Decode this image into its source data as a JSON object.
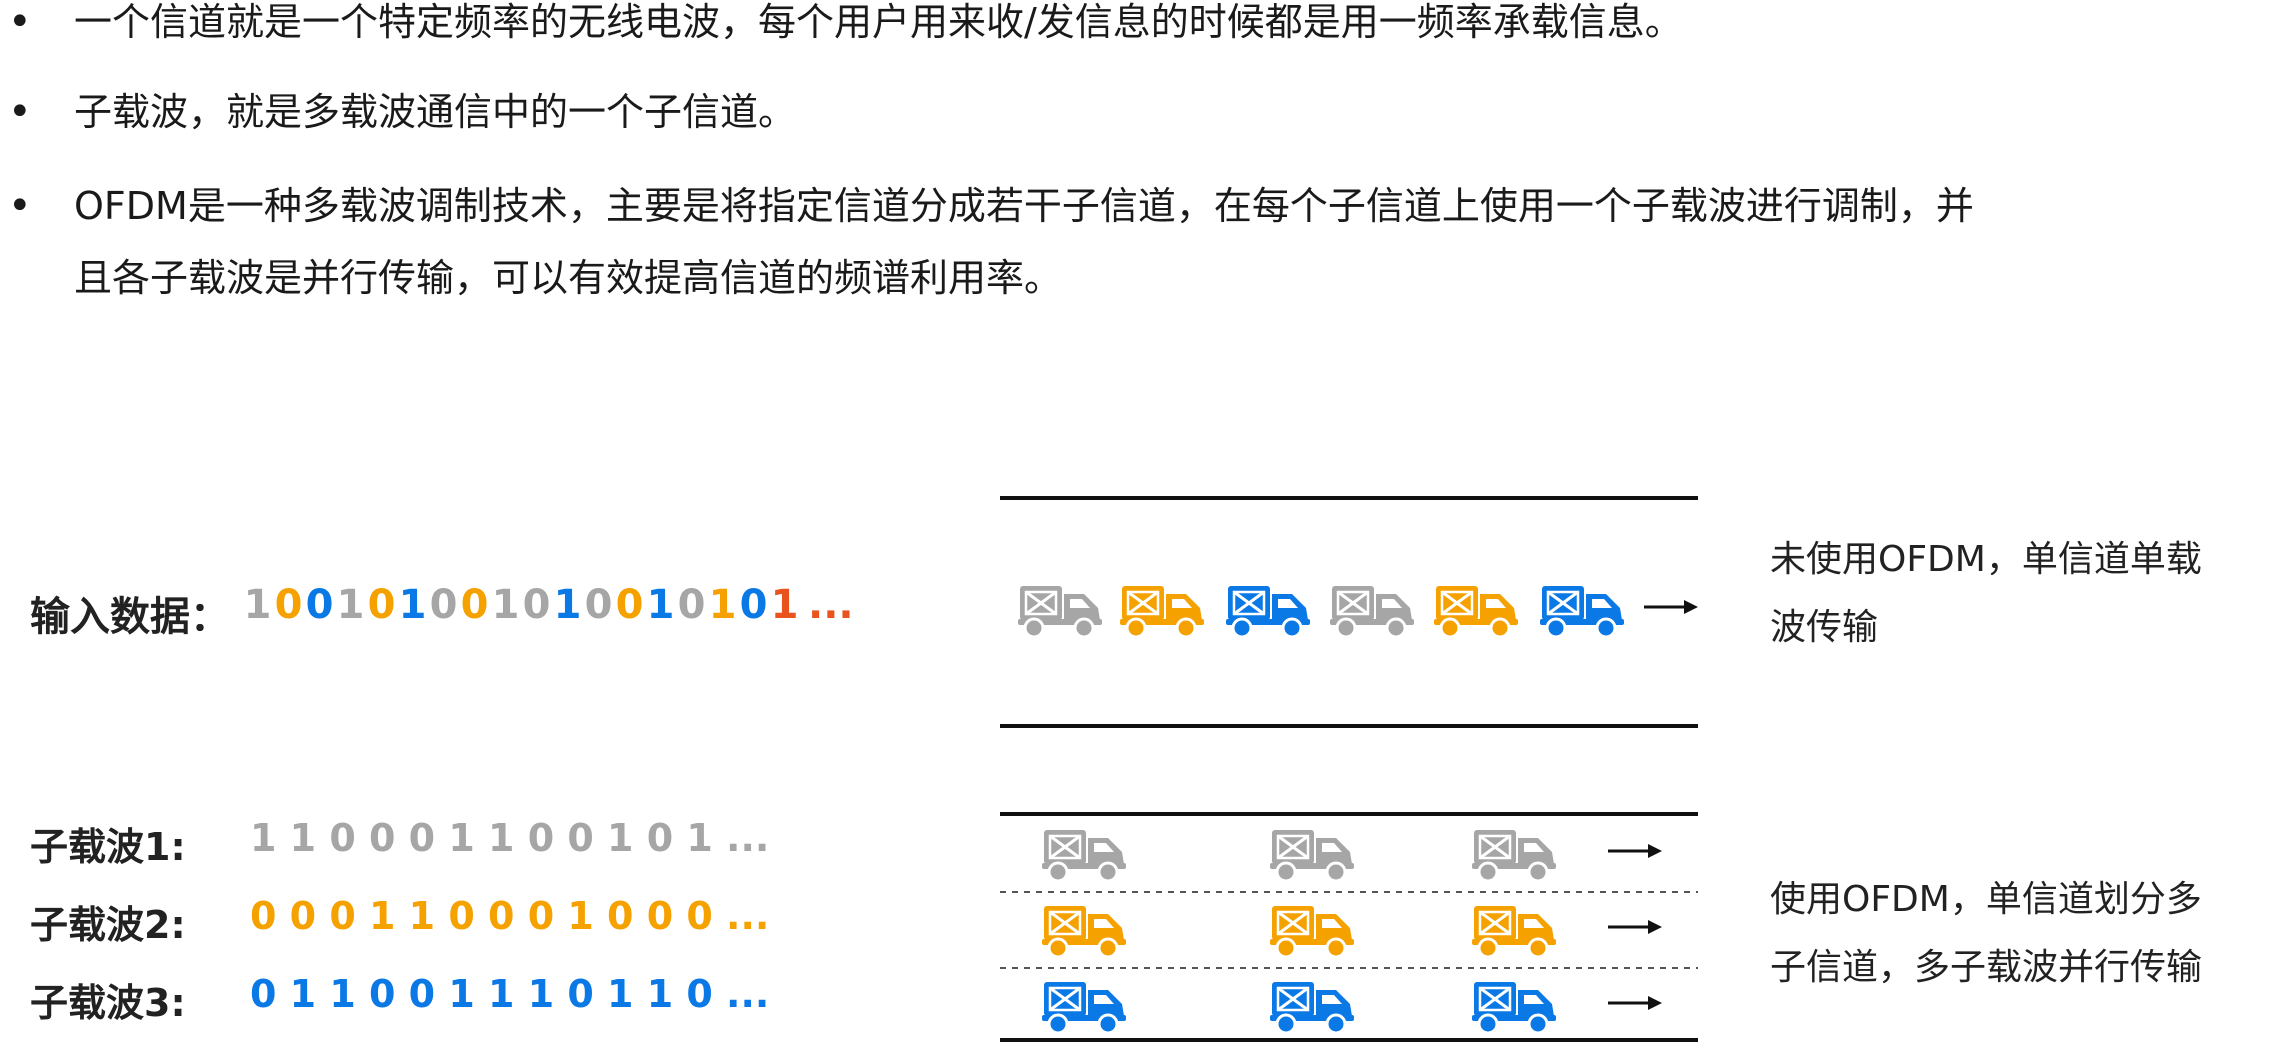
{
  "bullets": [
    {
      "symbol": "•",
      "text": "一个信道就是一个特定频率的无线电波，每个用户用来收/发信息的时候都是用一频率承载信息。"
    },
    {
      "symbol": "•",
      "text": "子载波，就是多载波通信中的一个子信道。"
    },
    {
      "symbol": "•",
      "text": "OFDM是一种多载波调制技术，主要是将指定信道分成若干子信道，在每个子信道上使用一个子载波进行调制，并\n且各子载波是并行传输，可以有效提高信道的频谱利用率。"
    }
  ],
  "input": {
    "label": "输入数据：",
    "bits": [
      "1",
      "0",
      "0",
      "1",
      "0",
      "1",
      "0",
      "0",
      "1",
      "0",
      "1",
      "0",
      "0",
      "1",
      "0",
      "1",
      "0",
      "1"
    ],
    "bit_colors": [
      "gray",
      "orange",
      "blue",
      "gray",
      "orange",
      "blue",
      "gray",
      "orange",
      "gray",
      "gray",
      "blue",
      "gray",
      "orange",
      "blue",
      "gray",
      "orange",
      "blue",
      "red"
    ],
    "ellipsis": "..."
  },
  "subcarriers": [
    {
      "label": "子载波1:",
      "bits": "1 1 0 0 0 1 1 0 0 1 0 1 ...",
      "color": "gray"
    },
    {
      "label": "子载波2:",
      "bits": "0 0 0 1 1 0 0 0 1 0 0 0 ...",
      "color": "orange"
    },
    {
      "label": "子载波3:",
      "bits": "0 1 1 0 0 1 1 1 0 1 1 0 ...",
      "color": "blue"
    }
  ],
  "captions": {
    "single": "未使用OFDM，单信道单载\n波传输",
    "multi": "使用OFDM，单信道划分多\n子信道，多子载波并行传输"
  },
  "top_lane_trucks": [
    "gray",
    "orange",
    "blue",
    "gray",
    "orange",
    "blue"
  ],
  "sub_lane_trucks": [
    [
      "gray",
      "gray",
      "gray"
    ],
    [
      "orange",
      "orange",
      "orange"
    ],
    [
      "blue",
      "blue",
      "blue"
    ]
  ],
  "colors": {
    "gray": "#a6a6a6",
    "orange": "#f5a100",
    "blue": "#0a79e6",
    "red": "#e8531e",
    "line": "#111111",
    "dash": "#555555"
  },
  "icons": {
    "truck": "delivery-truck-icon",
    "arrow": "right-arrow-icon",
    "bullet": "bullet-dot-icon"
  }
}
